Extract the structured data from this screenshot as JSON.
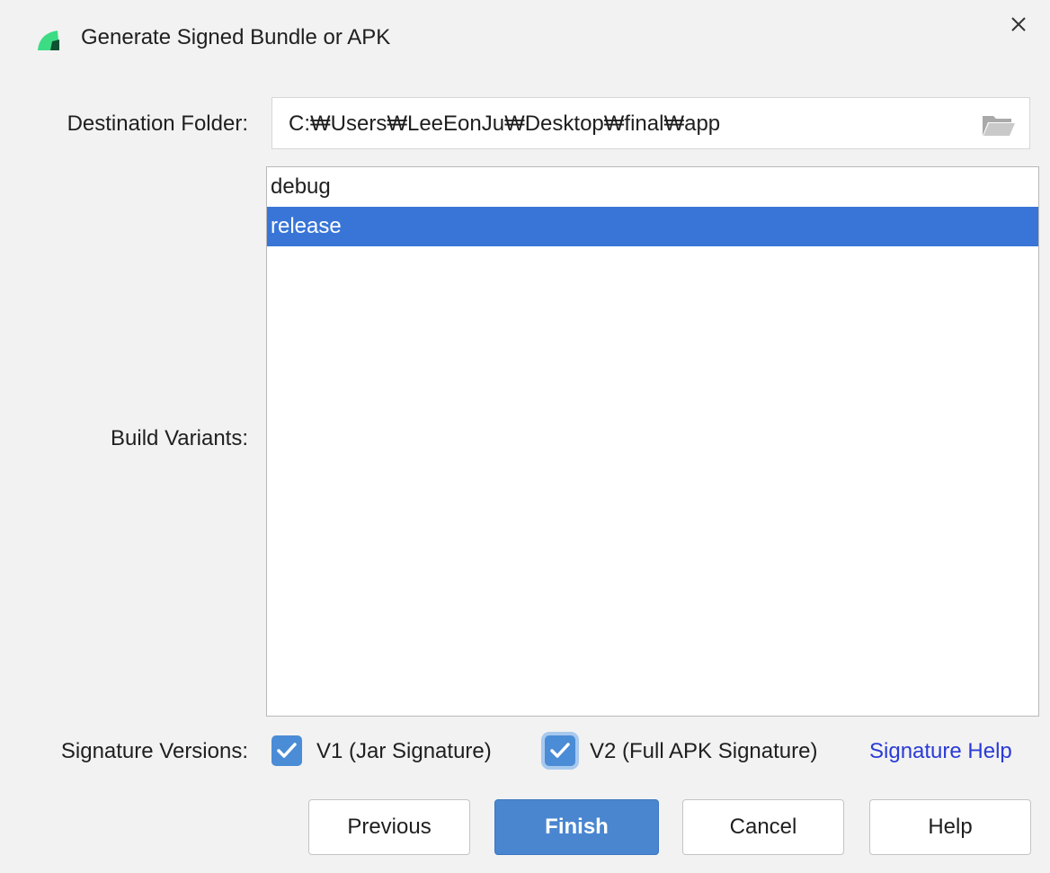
{
  "dialog": {
    "title": "Generate Signed Bundle or APK"
  },
  "destination": {
    "label": "Destination Folder:",
    "value": "C:₩Users₩LeeEonJu₩Desktop₩final₩app",
    "browse_icon": "folder-open-icon"
  },
  "build_variants": {
    "label": "Build Variants:",
    "items": [
      {
        "label": "debug",
        "selected": false
      },
      {
        "label": "release",
        "selected": true
      }
    ]
  },
  "signature": {
    "label": "Signature Versions:",
    "v1": {
      "label": "V1 (Jar Signature)",
      "checked": true
    },
    "v2": {
      "label": "V2 (Full APK Signature)",
      "checked": true
    },
    "help_link": "Signature Help"
  },
  "buttons": {
    "previous": "Previous",
    "finish": "Finish",
    "cancel": "Cancel",
    "help": "Help"
  },
  "colors": {
    "selection": "#3875d7",
    "primary_button": "#4a86cf",
    "checkbox": "#4a8cd6",
    "link": "#2a3bd6",
    "logo": "#3ddc84"
  }
}
